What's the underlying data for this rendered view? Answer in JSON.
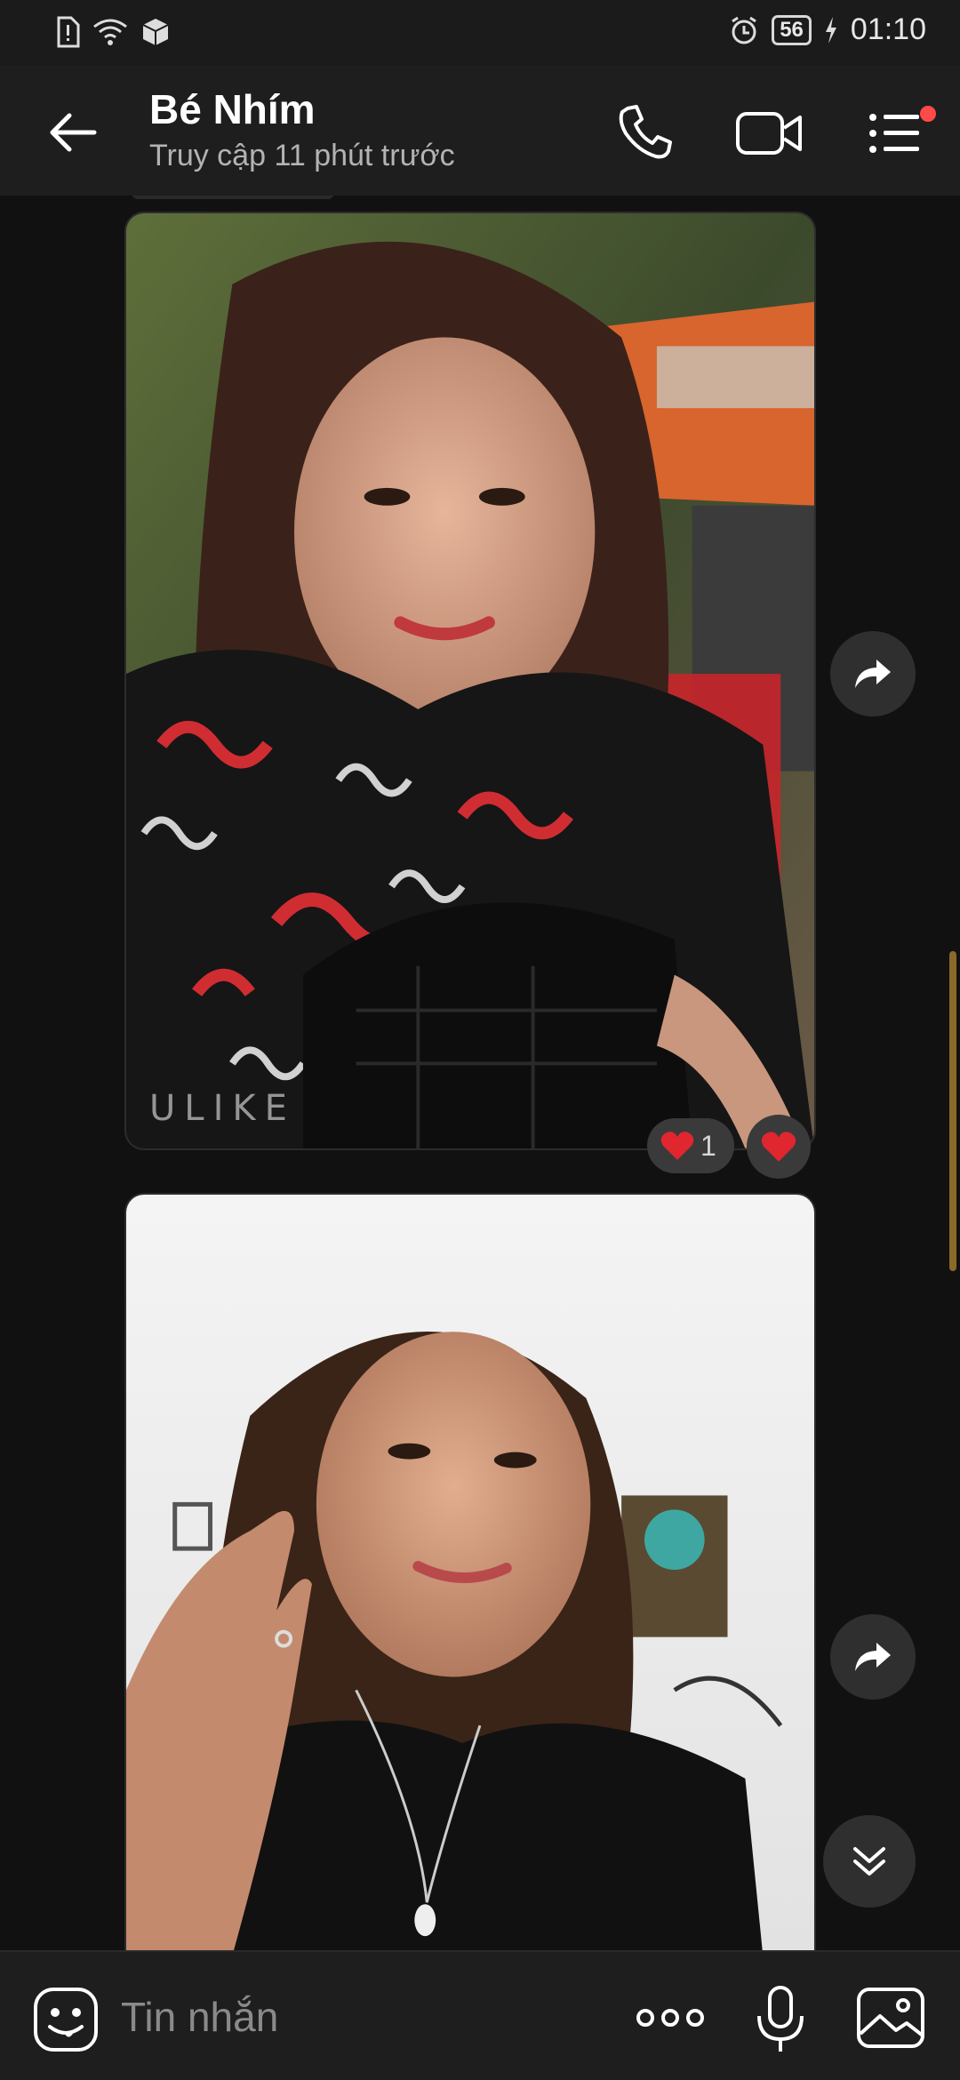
{
  "status_bar": {
    "time": "01:10",
    "battery": "56"
  },
  "header": {
    "contact_name": "Bé Nhím",
    "last_seen": "Truy cập 11 phút trước"
  },
  "messages": [
    {
      "type": "photo",
      "watermark": "ULIKE",
      "reaction_count": "1"
    },
    {
      "type": "photo"
    }
  ],
  "composer": {
    "placeholder": "Tin nhắn"
  },
  "colors": {
    "background": "#111112",
    "bar": "#1e1e1f",
    "reaction_red": "#e0262f",
    "notification_dot": "#ff4a4a"
  }
}
